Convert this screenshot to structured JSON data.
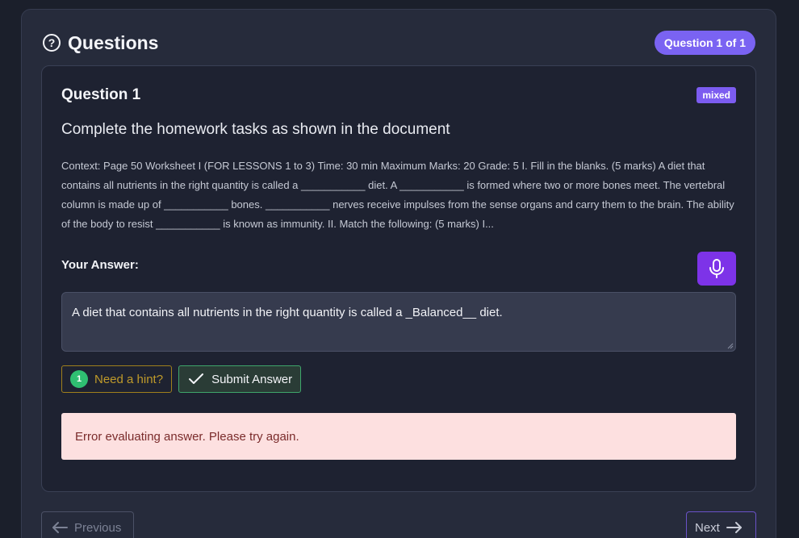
{
  "header": {
    "title": "Questions",
    "counter": "Question 1 of 1"
  },
  "question": {
    "label": "Question 1",
    "type_badge": "mixed",
    "text": "Complete the homework tasks as shown in the document",
    "context": "Context: Page 50 Worksheet I (FOR LESSONS 1 to 3) Time: 30 min Maximum Marks: 20 Grade: 5 I. Fill in the blanks. (5 marks) A diet that contains all nutrients in the right quantity is called a ___________ diet. A ___________ is formed where two or more bones meet. The vertebral column is made up of ___________ bones. ___________ nerves receive impulses from the sense organs and carry them to the brain. The ability of the body to resist ___________ is known as immunity. II. Match the following: (5 marks) I..."
  },
  "answer": {
    "label": "Your Answer:",
    "value": "A diet that contains all nutrients in the right quantity is called a _Balanced__ diet."
  },
  "actions": {
    "hint_count": "1",
    "hint_label": "Need a hint?",
    "submit_label": "Submit Answer"
  },
  "error": {
    "message": "Error evaluating answer. Please try again."
  },
  "nav": {
    "prev_label": "Previous",
    "next_label": "Next"
  },
  "colors": {
    "accent": "#7a63f2",
    "mic": "#7d33e8",
    "hint": "#bf9a2a",
    "success": "#2fbf72",
    "error_bg": "#fde0e0"
  },
  "icons": {
    "header": "question-circle-icon",
    "mic": "microphone-icon",
    "submit": "checkmark-icon",
    "prev": "arrow-left-icon",
    "next": "arrow-right-icon"
  }
}
